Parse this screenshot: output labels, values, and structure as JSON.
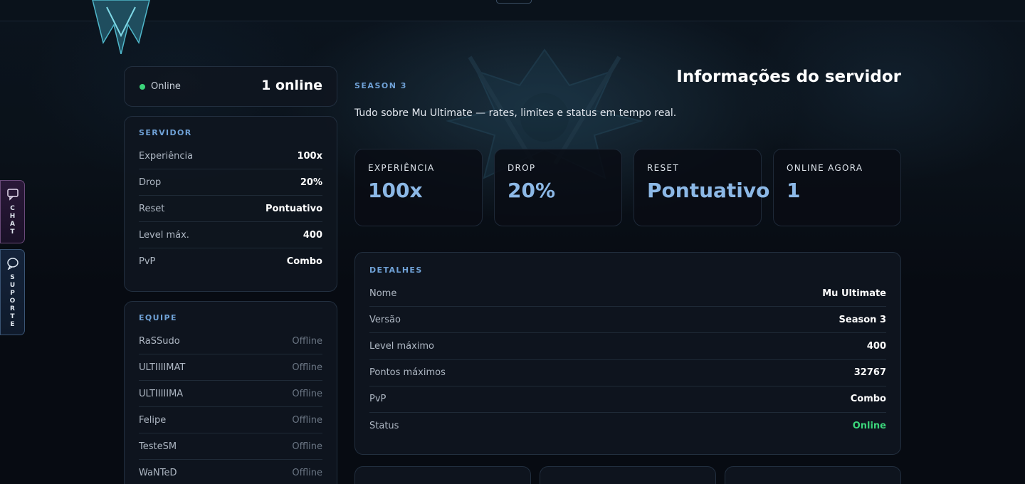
{
  "online_widget": {
    "status": "Online",
    "count": "1 online"
  },
  "float_tabs": {
    "chat": "CHAT",
    "support": "SUPORTE"
  },
  "server": {
    "label": "SERVIDOR",
    "rows": [
      {
        "k": "Experiência",
        "v": "100x"
      },
      {
        "k": "Drop",
        "v": "20%"
      },
      {
        "k": "Reset",
        "v": "Pontuativo"
      },
      {
        "k": "Level máx.",
        "v": "400"
      },
      {
        "k": "PvP",
        "v": "Combo"
      }
    ]
  },
  "team": {
    "label": "EQUIPE",
    "rows": [
      {
        "k": "RaSSudo",
        "v": "Offline"
      },
      {
        "k": "ULTIIIIMAT",
        "v": "Offline"
      },
      {
        "k": "ULTIIIIIMA",
        "v": "Offline"
      },
      {
        "k": "Felipe",
        "v": "Offline"
      },
      {
        "k": "TesteSM",
        "v": "Offline"
      },
      {
        "k": "WaNTeD",
        "v": "Offline"
      }
    ]
  },
  "header": {
    "season": "SEASON 3",
    "title": "Informações do servidor",
    "subtitle": "Tudo sobre Mu Ultimate — rates, limites e status em tempo real."
  },
  "stats": [
    {
      "label": "EXPERIÊNCIA",
      "value": "100x"
    },
    {
      "label": "DROP",
      "value": "20%"
    },
    {
      "label": "RESET",
      "value": "Pontuativo"
    },
    {
      "label": "ONLINE AGORA",
      "value": "1"
    }
  ],
  "details": {
    "label": "DETALHES",
    "rows": [
      {
        "k": "Nome",
        "v": "Mu Ultimate"
      },
      {
        "k": "Versão",
        "v": "Season 3"
      },
      {
        "k": "Level máximo",
        "v": "400"
      },
      {
        "k": "Pontos máximos",
        "v": "32767"
      },
      {
        "k": "PvP",
        "v": "Combo"
      },
      {
        "k": "Status",
        "v": "Online"
      }
    ]
  },
  "colors": {
    "accent": "#8cb8e6",
    "label_blue": "#6fa1d6",
    "online_green": "#3bd47a"
  }
}
